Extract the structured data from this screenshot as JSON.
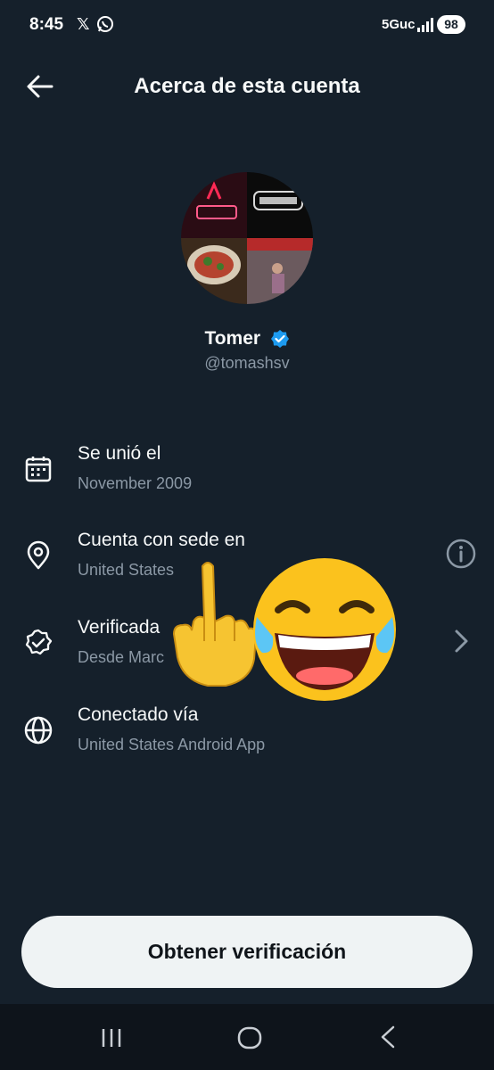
{
  "status_bar": {
    "time": "8:45",
    "x_label": "𝕏",
    "network": "5Guc",
    "battery": "98"
  },
  "header": {
    "title": "Acerca de esta cuenta",
    "back_icon": "arrow-left-icon"
  },
  "profile": {
    "name": "Tomer",
    "handle": "@tomashsv",
    "verified": true,
    "verified_color": "#1d9bf0"
  },
  "info_rows": [
    {
      "icon": "calendar-icon",
      "title": "Se unió el",
      "subtitle": "November 2009"
    },
    {
      "icon": "location-pin-icon",
      "title": "Cuenta con sede en",
      "subtitle": "United States",
      "action_icon": "info-icon"
    },
    {
      "icon": "verified-check-icon",
      "title": "Verificada",
      "subtitle": "Desde Marc",
      "action_icon": "chevron-right-icon"
    },
    {
      "icon": "globe-icon",
      "title": "Conectado vía",
      "subtitle": "United States Android App"
    }
  ],
  "overlay_emojis": [
    "middle-finger-emoji",
    "tears-of-joy-emoji"
  ],
  "cta": {
    "label": "Obtener verificación"
  },
  "nav_bar": {
    "icons": [
      "recent-apps-icon",
      "home-icon",
      "back-icon"
    ]
  },
  "colors": {
    "background": "#15202b",
    "text_primary": "#f7f9f9",
    "text_secondary": "#8b98a5",
    "button_bg": "#eff3f4"
  }
}
